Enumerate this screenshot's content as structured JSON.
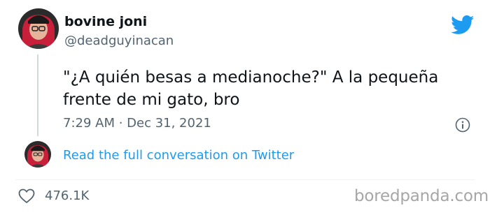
{
  "tweet": {
    "author": {
      "display_name": "bovine joni",
      "handle": "@deadguyinacan",
      "avatar_icon": "user-avatar-photo"
    },
    "text_lines": [
      "\"¿A quién besas a medianoche?\" A la pequeña",
      "frente de mi gato, bro"
    ],
    "timestamp": "7:29 AM · Dec 31, 2021",
    "info_icon": "info-icon",
    "brand_icon": "twitter-bird-icon",
    "brand_color": "#1d9bf0"
  },
  "conversation": {
    "link_label": "Read the full conversation on Twitter"
  },
  "engagement": {
    "likes_icon": "heart-icon",
    "likes_count": "476.1K"
  },
  "watermark": {
    "text": "boredpanda.com"
  }
}
